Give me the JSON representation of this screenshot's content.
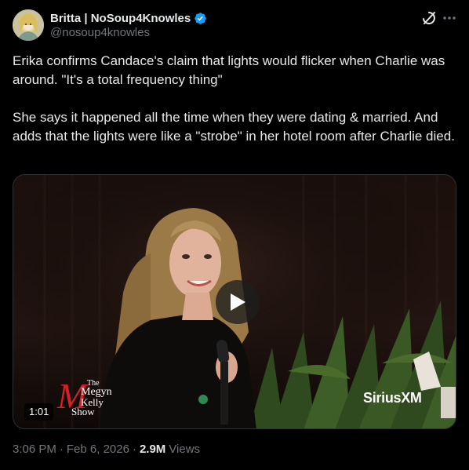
{
  "author": {
    "display_name": "Britta | NoSoup4Knowles",
    "handle": "@nosoup4knowles",
    "verified_icon": "verified-badge-icon",
    "verified_color": "#1d9bf0"
  },
  "actions": {
    "grok_icon": "grok-icon",
    "more_icon": "more-horizontal-icon"
  },
  "tweet": {
    "paragraph_1": "Erika confirms Candace's claim that lights would flicker when Charlie was around. \"It's a total frequency thing\"",
    "paragraph_2": "She says it happened all the time when they were dating & married. And adds that the lights were like a \"strobe\" in her hotel room after Charlie died."
  },
  "media": {
    "type": "video",
    "duration": "1:01",
    "play_icon": "play-icon",
    "logo_letter": "M",
    "logo_the": "The",
    "logo_megyn": "Megyn",
    "logo_kelly": "Kelly",
    "logo_show": "Show",
    "watermark": "SiriusXM"
  },
  "meta": {
    "time": "3:06 PM",
    "separator": "·",
    "date": "Feb 6, 2026",
    "views_count": "2.9M",
    "views_label": "Views"
  },
  "colors": {
    "background": "#000000",
    "text_primary": "#e7e9ea",
    "text_secondary": "#71767b",
    "border": "#2f3336",
    "brand_red": "#d42026"
  }
}
